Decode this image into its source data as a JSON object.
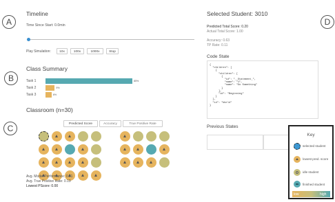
{
  "sections": {
    "a": "A",
    "b": "B",
    "c": "C",
    "d": "D"
  },
  "timeline": {
    "title": "Timeline",
    "time_label": "Time Since Start: 0.0min",
    "slider_value": 0,
    "play_label": "Play Simulation:",
    "speeds": [
      "10x",
      "100x",
      "1000x",
      "Stop"
    ]
  },
  "class_summary": {
    "title": "Class Summary",
    "tasks": [
      {
        "label": "Task 1",
        "value": "85%",
        "fraction": 0.85
      },
      {
        "label": "Task 2",
        "value": "9%",
        "fraction": 0.09
      },
      {
        "label": "Task 3",
        "value": "6%",
        "fraction": 0.06
      }
    ]
  },
  "classroom": {
    "title": "Classroom (n=30)",
    "tabs": [
      "Predicted Score",
      "Accuracy",
      "True Positive Rate"
    ],
    "stats": [
      "Avg. Model Performance: 0.81",
      "Avg. True Positive Rate: 0.19",
      "Lowest PScore: 0.00"
    ]
  },
  "student": {
    "title": "Selected Student: 3010",
    "predicted": "Predicted Total Score: 0.20",
    "actual": "Actual Total Score: 1.00",
    "accuracy": "Accuracy: 0.63",
    "tp_rate": "TP Rate: 0.11"
  },
  "code_state": {
    "title": "Code State",
    "lines": [
      "{",
      "  \"children\": [",
      "    {",
      "      \"children\": [",
      "        {",
      "          \"id\": \"__Statement_\",",
      "          \"name\": \"1\",",
      "          \"name\": \"Do Something\"",
      "        }",
      "      ],",
      "      \"id\": \"Beginning\"",
      "    }",
      "  ],",
      "  \"id\": \"World\"",
      "}"
    ]
  },
  "previous_states": {
    "title": "Previous States"
  },
  "key": {
    "title": "Key",
    "items": [
      "selected student",
      "lowest pred. score",
      "idle student",
      "finished student"
    ],
    "low": "low",
    "high": "high"
  },
  "colors": {
    "teal": "#56a9b1",
    "orange": "#e6b45e",
    "olive": "#c6bf7b",
    "blue": "#3d98d3"
  }
}
